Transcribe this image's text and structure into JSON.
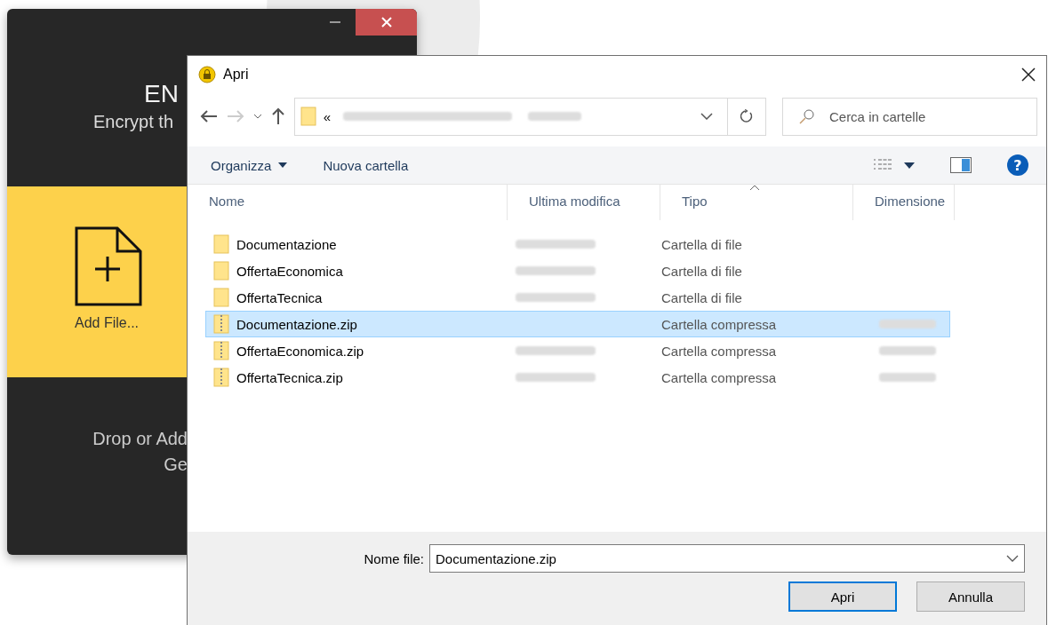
{
  "background_app": {
    "title_partial": "EN",
    "subtitle_partial": "Encrypt th",
    "add_label": "Add File...",
    "drop_line_1": "Drop or Add",
    "drop_line_2": "Ge"
  },
  "dialog": {
    "title": "Apri",
    "address": {
      "prefix": "«"
    },
    "search": {
      "placeholder": "Cerca in cartelle"
    },
    "toolbar": {
      "organize": "Organizza",
      "new_folder": "Nuova cartella",
      "help": "?"
    },
    "columns": [
      {
        "label": "Nome",
        "sorted": false
      },
      {
        "label": "Ultima modifica",
        "sorted": false
      },
      {
        "label": "Tipo",
        "sorted": true
      },
      {
        "label": "Dimensione",
        "sorted": false
      }
    ],
    "rows": [
      {
        "kind": "folder",
        "name": "Documentazione",
        "type": "Cartella di file",
        "selected": false
      },
      {
        "kind": "folder",
        "name": "OffertaEconomica",
        "type": "Cartella di file",
        "selected": false
      },
      {
        "kind": "folder",
        "name": "OffertaTecnica",
        "type": "Cartella di file",
        "selected": false
      },
      {
        "kind": "zip",
        "name": "Documentazione.zip",
        "type": "Cartella compressa",
        "selected": true
      },
      {
        "kind": "zip",
        "name": "OffertaEconomica.zip",
        "type": "Cartella compressa",
        "selected": false
      },
      {
        "kind": "zip",
        "name": "OffertaTecnica.zip",
        "type": "Cartella compressa",
        "selected": false
      }
    ],
    "filename": {
      "label": "Nome file:",
      "value": "Documentazione.zip"
    },
    "buttons": [
      {
        "label": "Apri",
        "default": true
      },
      {
        "label": "Annulla",
        "default": false
      }
    ]
  }
}
